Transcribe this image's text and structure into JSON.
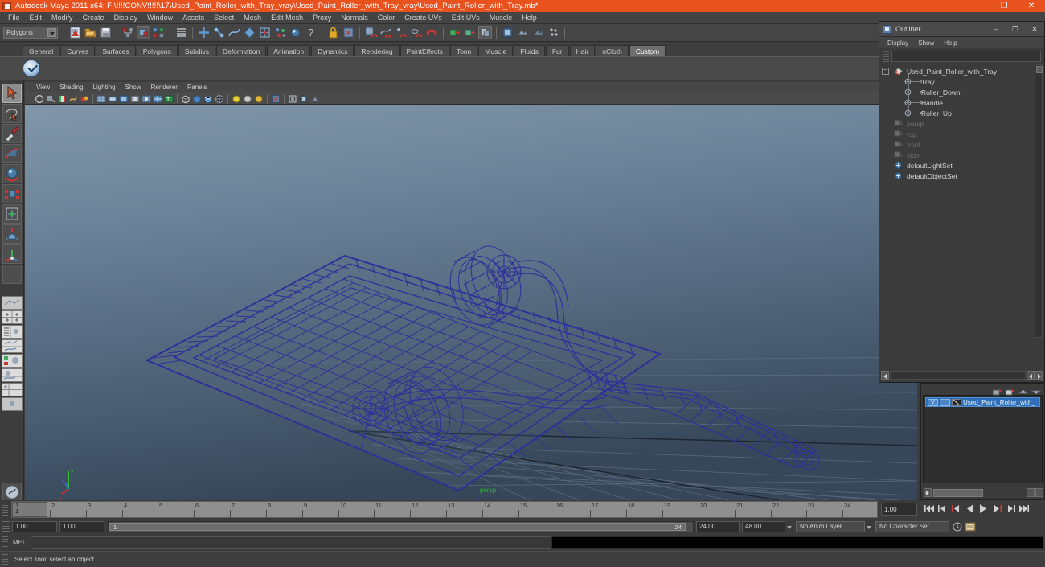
{
  "window": {
    "title": "Autodesk Maya 2011 x64: F:\\!!!!CONV!!!!!\\17\\Used_Paint_Roller_with_Tray_vray\\Used_Paint_Roller_with_Tray_vray\\Used_Paint_Roller_with_Tray.mb*",
    "icon": "maya-icon",
    "minimize": "–",
    "maximize": "❐",
    "close": "✕",
    "titlebar_color": "#e8521f"
  },
  "menubar": {
    "items": [
      "File",
      "Edit",
      "Modify",
      "Create",
      "Display",
      "Window",
      "Assets",
      "Select",
      "Mesh",
      "Edit Mesh",
      "Proxy",
      "Normals",
      "Color",
      "Create UVs",
      "Edit UVs",
      "Muscle",
      "Help"
    ]
  },
  "statusline": {
    "selection_mode": "Polygons",
    "icons": [
      "new-scene-icon",
      "open-scene-icon",
      "save-scene-icon",
      "select-hierarchy-icon",
      "select-object-icon",
      "select-component-icon",
      "component-mask-icon",
      "handle-mask-icon",
      "joint-mask-icon",
      "curve-mask-icon",
      "surface-mask-icon",
      "deformation-mask-icon",
      "dynamics-mask-icon",
      "rendering-mask-icon",
      "misc-mask-icon",
      "lock-icon",
      "highlight-icon",
      "snap-grid-icon",
      "snap-curve-icon",
      "snap-point-icon",
      "snap-projected-icon",
      "snap-view-plane-icon",
      "input-connection-icon",
      "output-connection-icon",
      "construction-history-icon",
      "render-view-icon",
      "render-current-frame-icon",
      "ipr-render-icon",
      "render-settings-icon"
    ]
  },
  "shelf": {
    "tabs": [
      "General",
      "Curves",
      "Surfaces",
      "Polygons",
      "Subdivs",
      "Deformation",
      "Animation",
      "Dynamics",
      "Rendering",
      "PaintEffects",
      "Toon",
      "Muscle",
      "Fluids",
      "Fur",
      "Hair",
      "nCloth",
      "Custom"
    ],
    "active_tab": "Custom",
    "buttons": [
      "custom-check-icon"
    ]
  },
  "toolbox": {
    "items": [
      {
        "name": "select-tool",
        "active": true
      },
      {
        "name": "lasso-select-tool",
        "active": false
      },
      {
        "name": "paint-select-tool",
        "active": false
      },
      {
        "name": "move-tool",
        "active": false
      },
      {
        "name": "rotate-tool",
        "active": false
      },
      {
        "name": "scale-tool",
        "active": false
      },
      {
        "name": "universal-manipulator-tool",
        "active": false
      },
      {
        "name": "soft-modification-tool",
        "active": false
      },
      {
        "name": "show-manipulator-tool",
        "active": false
      },
      {
        "name": "last-tool-used",
        "active": false
      }
    ],
    "layouts": [
      "single-perspective-layout",
      "four-view-layout",
      "outliner-persp-layout",
      "persp-graph-layout",
      "hypershade-persp-layout",
      "persp-trax-layout",
      "multi-layout",
      "paint-effects-layout"
    ]
  },
  "viewport": {
    "menus": [
      "View",
      "Shading",
      "Lighting",
      "Show",
      "Renderer",
      "Panels"
    ],
    "camera_label": "persp",
    "camera_label_color": "#2bbb33",
    "wireframe_color": "#2e2e9c",
    "background_top": "#7e93a6",
    "background_bottom": "#38485a",
    "axis_labels": [
      "x",
      "y",
      "z"
    ],
    "toolbar_icons": [
      "select-camera-icon",
      "lock-camera-icon",
      "camera-attributes-icon",
      "bookmarks-icon",
      "image-plane-icon",
      "two-d-pan-zoom-icon",
      "grease-pencil-icon",
      "resolution-gate-icon",
      "film-gate-icon",
      "gate-mask-icon",
      "field-chart-icon",
      "safe-action-icon",
      "wireframe-shading-icon",
      "smooth-shade-all-icon",
      "smooth-shade-textured-icon",
      "wireframe-on-shaded-icon",
      "use-default-lighting-icon",
      "use-all-lights-icon",
      "shadows-icon",
      "xray-icon",
      "isolate-select-icon",
      "paint-effects-icon",
      "exposure-icon"
    ]
  },
  "outliner": {
    "title": "Outliner",
    "icon": "outliner-icon",
    "minimize": "–",
    "maximize": "❐",
    "close": "✕",
    "menus": [
      "Display",
      "Show",
      "Help"
    ],
    "search_value": "",
    "nodes": [
      {
        "label": "Used_Paint_Roller_with_Tray",
        "indent": 0,
        "icon": "transform-icon",
        "dim": false,
        "expandable": true
      },
      {
        "label": "Tray",
        "indent": 1,
        "icon": "mesh-icon",
        "dim": false,
        "expandable": false
      },
      {
        "label": "Roller_Down",
        "indent": 1,
        "icon": "mesh-icon",
        "dim": false,
        "expandable": false
      },
      {
        "label": "Handle",
        "indent": 1,
        "icon": "mesh-icon",
        "dim": false,
        "expandable": false
      },
      {
        "label": "Roller_Up",
        "indent": 1,
        "icon": "mesh-icon",
        "dim": false,
        "expandable": false
      },
      {
        "label": "persp",
        "indent": 0,
        "icon": "camera-icon",
        "dim": true,
        "expandable": false
      },
      {
        "label": "top",
        "indent": 0,
        "icon": "camera-icon",
        "dim": true,
        "expandable": false
      },
      {
        "label": "front",
        "indent": 0,
        "icon": "camera-icon",
        "dim": true,
        "expandable": false
      },
      {
        "label": "side",
        "indent": 0,
        "icon": "camera-icon",
        "dim": true,
        "expandable": false
      },
      {
        "label": "defaultLightSet",
        "indent": 0,
        "icon": "set-icon",
        "dim": false,
        "expandable": false
      },
      {
        "label": "defaultObjectSet",
        "indent": 0,
        "icon": "set-icon",
        "dim": false,
        "expandable": false
      }
    ]
  },
  "layer_editor": {
    "layers": [
      {
        "visibility": "V",
        "playback": "",
        "name": "Used_Paint_Roller_with_"
      }
    ],
    "tool_icons": [
      "new-layer-icon",
      "new-layer-selected-icon",
      "move-layer-up-icon",
      "move-layer-down-icon"
    ]
  },
  "timeslider": {
    "ticks": [
      1,
      2,
      3,
      4,
      5,
      6,
      7,
      8,
      9,
      10,
      11,
      12,
      13,
      14,
      15,
      16,
      17,
      18,
      19,
      20,
      21,
      22,
      23,
      24
    ],
    "current_frame_marker": "1",
    "current_frame_field": "1.00",
    "playback_buttons": [
      "go-to-start-icon",
      "step-back-frame-icon",
      "step-back-key-icon",
      "play-backwards-icon",
      "play-forwards-icon",
      "step-forward-key-icon",
      "step-forward-frame-icon",
      "go-to-end-icon"
    ]
  },
  "rangeslider": {
    "start_field": "1.00",
    "start2_field": "1.00",
    "range_start_label": "1",
    "range_end_label": "24",
    "end_field": "24.00",
    "end2_field": "48.00",
    "anim_layer": "No Anim Layer",
    "character_set": "No Character Set",
    "auto_key_icon": "auto-keyframe-icon",
    "prefs_icon": "animation-preferences-icon"
  },
  "commandline": {
    "label": "MEL",
    "input_value": "",
    "output_value": ""
  },
  "helpline": {
    "text": "Select Tool: select an object"
  }
}
